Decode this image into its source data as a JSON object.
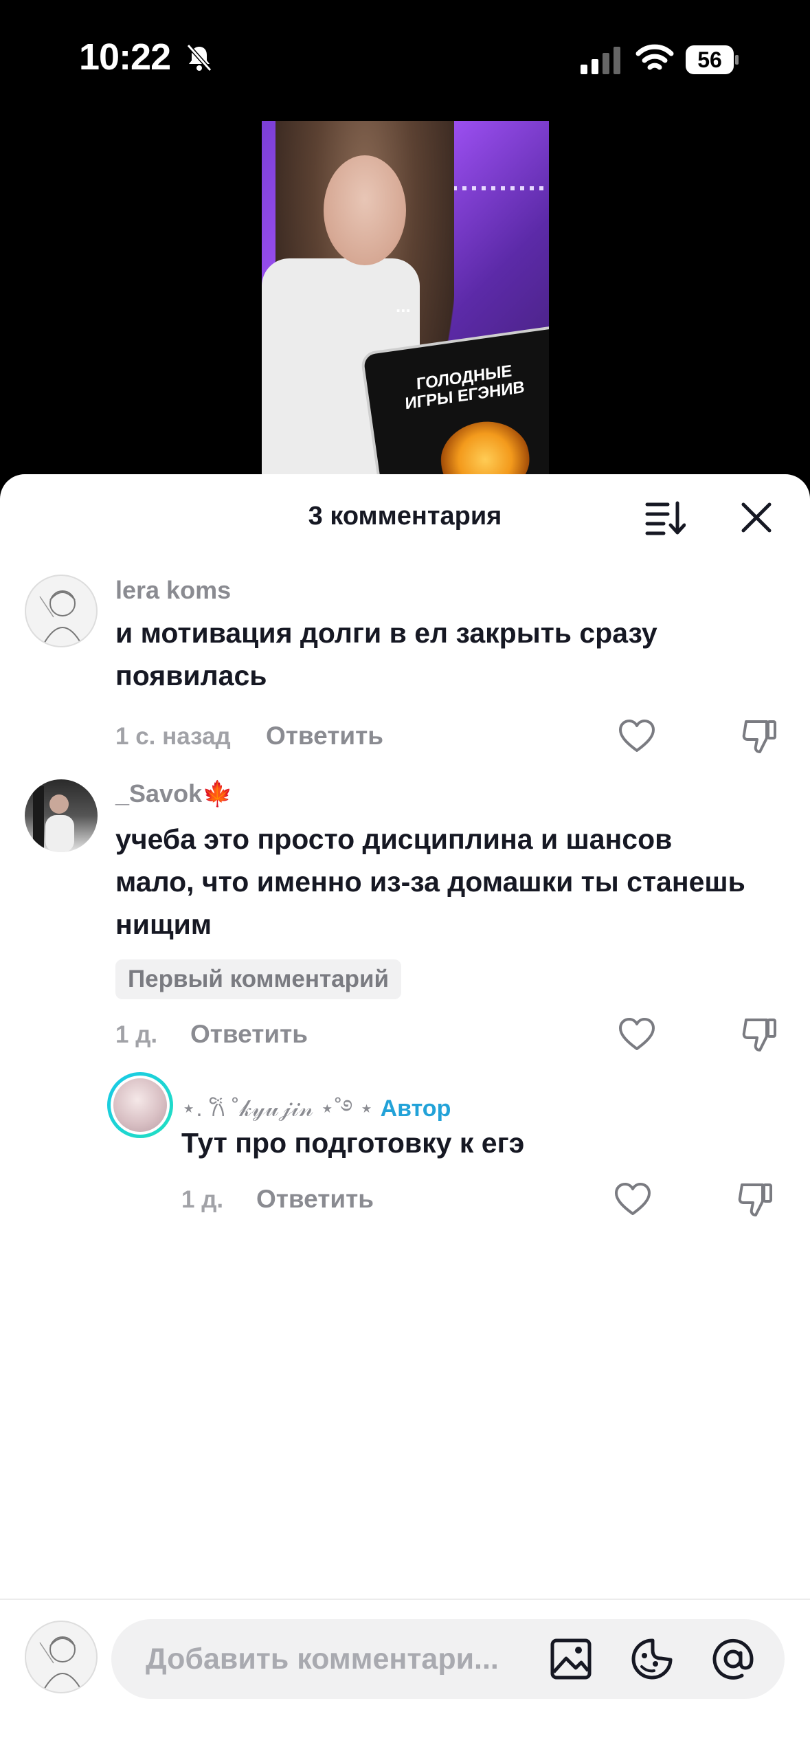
{
  "status_bar": {
    "time": "10:22",
    "battery": "56"
  },
  "video": {
    "tablet_title": "ГОЛОДНЫЕ ИГРЫ ЕГЭНИВ",
    "more": "..."
  },
  "sheet": {
    "title": "3 комментария"
  },
  "comments": [
    {
      "username": "lera koms",
      "text": "и мотивация долги в ел закрыть сразу появилась",
      "time": "1 с. назад",
      "reply_label": "Ответить"
    },
    {
      "username": "_Savok🍁",
      "text": "учеба это просто дисциплина и шансов мало, что именно из-за домашки ты станешь нищим",
      "badge": "Первый комментарий",
      "time": "1 д.",
      "reply_label": "Ответить"
    }
  ],
  "reply": {
    "username": "⋆. 𐙚 ˚𝓀𝓎𝓊𝒿𝒾𝓃 ⋆˚࿔ ⋆",
    "author_tag": "Автор",
    "text": "Тут про подготовку к егэ",
    "time": "1 д.",
    "reply_label": "Ответить"
  },
  "composer": {
    "placeholder": "Добавить комментари..."
  }
}
